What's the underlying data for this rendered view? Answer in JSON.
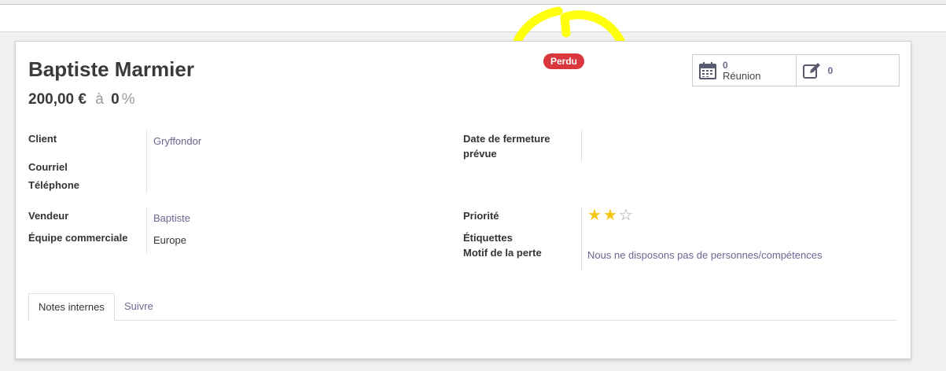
{
  "header": {
    "name": "Baptiste Marmier",
    "revenue": "200,00 €",
    "at_word": "à",
    "probability": "0",
    "percent_sign": "%",
    "status_badge": "Perdu"
  },
  "stat_buttons": {
    "meetings_count": "0",
    "meetings_label": "Réunion",
    "notes_count": "0"
  },
  "fields": {
    "client_label": "Client",
    "client_value": "Gryffondor",
    "email_label": "Courriel",
    "phone_label": "Téléphone",
    "close_date_label_1": "Date de fermeture",
    "close_date_label_2": "prévue",
    "salesperson_label": "Vendeur",
    "salesperson_value": "Baptiste",
    "team_label": "Équipe commerciale",
    "team_value": "Europe",
    "priority_label": "Priorité",
    "priority_stars": 2,
    "priority_max": 3,
    "tags_label": "Étiquettes",
    "lost_reason_label": "Motif de la perte",
    "lost_reason_value": "Nous ne disposons pas de personnes/compétences"
  },
  "tabs": {
    "internal_notes": "Notes internes",
    "follow": "Suivre"
  },
  "colors": {
    "accent": "#6f6390",
    "badge": "#d9363e",
    "star": "#f3c612",
    "highlight": "#ffff00"
  }
}
